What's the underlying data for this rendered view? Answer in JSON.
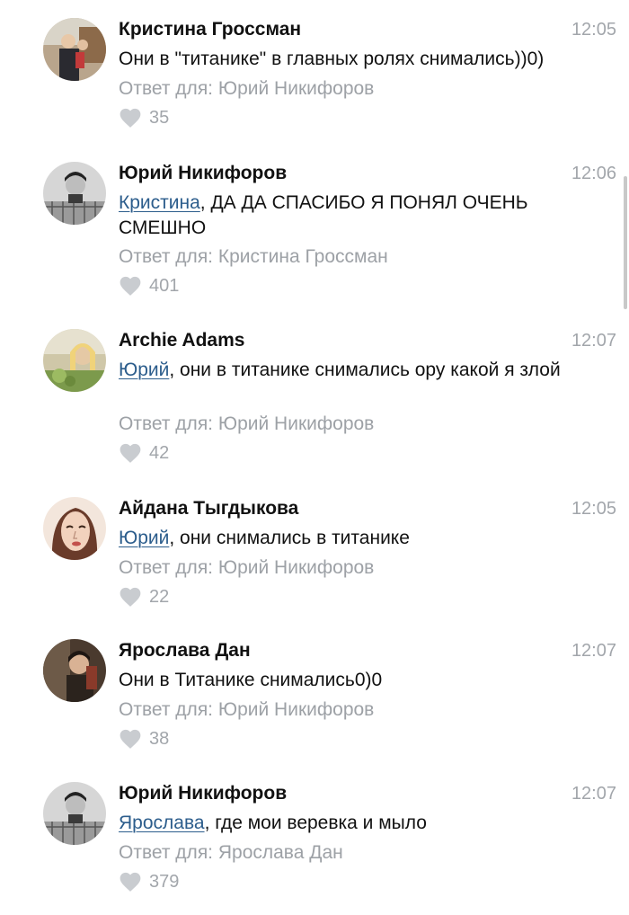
{
  "comments": [
    {
      "author": "Кристина Гроссман",
      "time": "12:05",
      "mention": "",
      "body": "Они в \"титанике\" в главных ролях снимались))0)",
      "reply_to": "Ответ для: Юрий Никифоров",
      "likes": "35"
    },
    {
      "author": "Юрий Никифоров",
      "time": "12:06",
      "mention": "Кристина",
      "body": ", ДА ДА СПАСИБО Я ПОНЯЛ ОЧЕНЬ СМЕШНО",
      "reply_to": "Ответ для: Кристина Гроссман",
      "likes": "401"
    },
    {
      "author": "Archie Adams",
      "time": "12:07",
      "mention": "Юрий",
      "body": ", они в титанике снимались ору какой я злой",
      "reply_to": "Ответ для: Юрий Никифоров",
      "likes": "42"
    },
    {
      "author": "Айдана Тыгдыкова",
      "time": "12:05",
      "mention": "Юрий",
      "body": ", они снимались в титанике",
      "reply_to": "Ответ для: Юрий Никифоров",
      "likes": "22"
    },
    {
      "author": "Ярослава Дан",
      "time": "12:07",
      "mention": "",
      "body": "Они в Титанике снимались0)0",
      "reply_to": "Ответ для: Юрий Никифоров",
      "likes": "38"
    },
    {
      "author": "Юрий Никифоров",
      "time": "12:07",
      "mention": "Ярослава",
      "body": ", где мои веревка и мыло",
      "reply_to": "Ответ для: Ярослава Дан",
      "likes": "379"
    }
  ],
  "colors": {
    "mention": "#2c5d8c",
    "muted": "#a2a6ab",
    "heart": "#c9ccd0"
  },
  "icons": {
    "like": "heart-icon"
  }
}
